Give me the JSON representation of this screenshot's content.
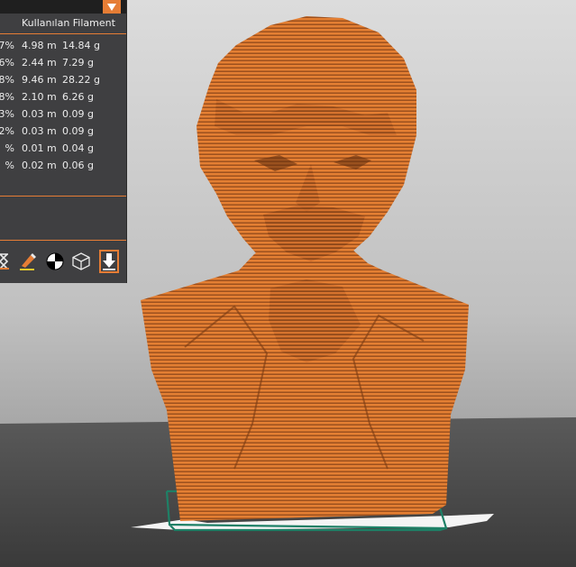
{
  "panel": {
    "column_header": "Kullanılan Filament",
    "rows": [
      {
        "pct": "7%",
        "length": "4.98 m",
        "weight": "14.84 g"
      },
      {
        "pct": "6%",
        "length": "2.44 m",
        "weight": "7.29 g"
      },
      {
        "pct": "8%",
        "length": "9.46 m",
        "weight": "28.22 g"
      },
      {
        "pct": "8%",
        "length": "2.10 m",
        "weight": "6.26 g"
      },
      {
        "pct": "3%",
        "length": "0.03 m",
        "weight": "0.09 g"
      },
      {
        "pct": "2%",
        "length": "0.03 m",
        "weight": "0.09 g"
      },
      {
        "pct": "%",
        "length": "0.01 m",
        "weight": "0.04 g"
      },
      {
        "pct": "%",
        "length": "0.02 m",
        "weight": "0.06 g"
      }
    ]
  },
  "toolbar": {
    "icons": [
      "hourglass-icon",
      "paint-pen-icon",
      "center-of-gravity-icon",
      "wireframe-cube-icon",
      "download-arrow-icon"
    ]
  },
  "colors": {
    "accent": "#e67d35",
    "model": "#e07a2e",
    "panel_bg": "#3f3f41",
    "bed": "#4b4b4b",
    "bed_outline": "#1e8066"
  }
}
